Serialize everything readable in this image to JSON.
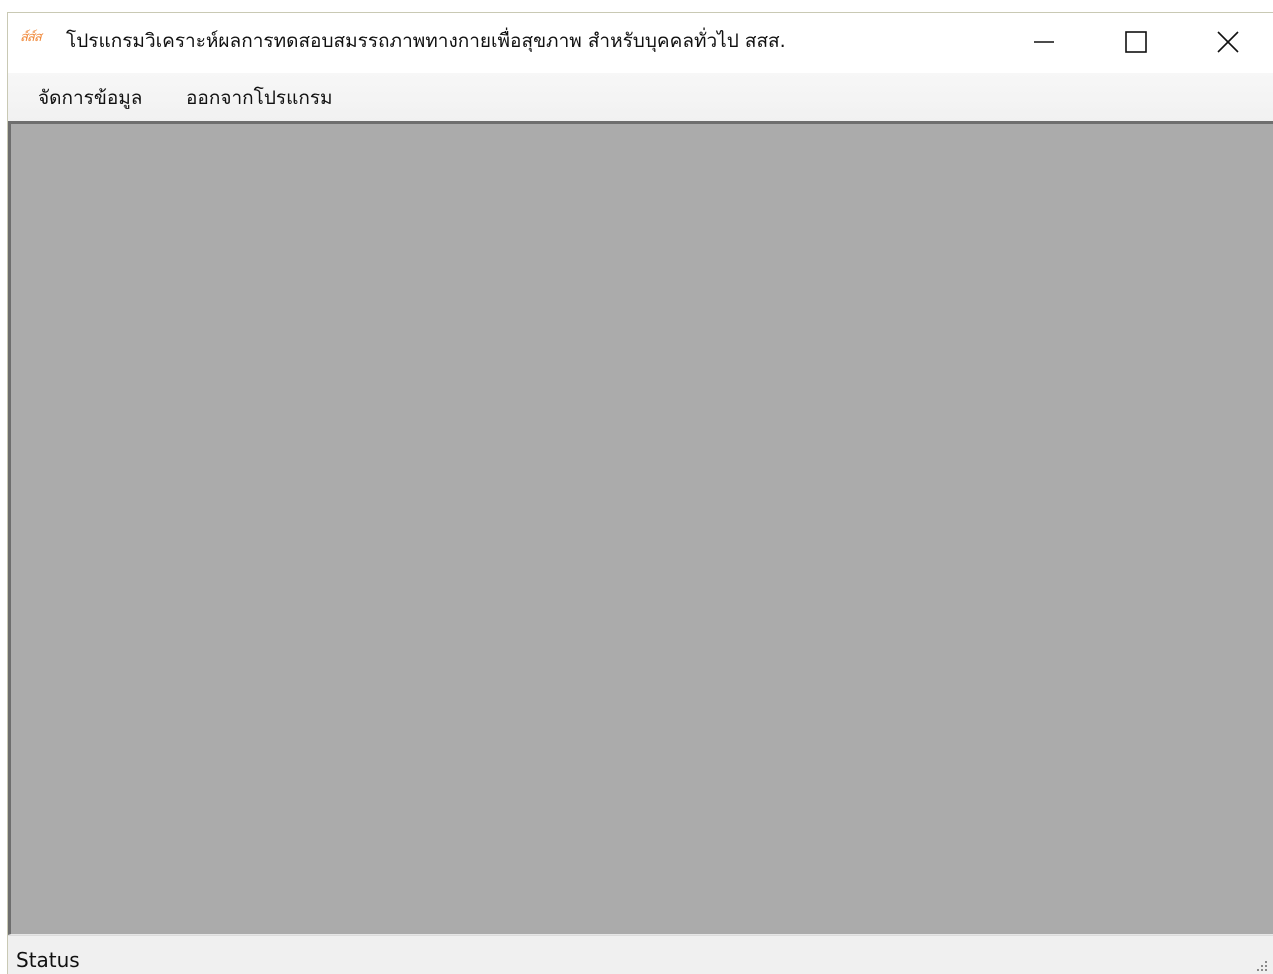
{
  "window": {
    "icon_text": "ส์ส์ส",
    "title": "โปรแกรมวิเคราะห์ผลการทดสอบสมรรถภาพทางกายเพื่อสุขภาพ สำหรับบุคคลทั่วไป สสส.",
    "controls": {
      "minimize": "minimize-icon",
      "maximize": "maximize-icon",
      "close": "close-icon"
    }
  },
  "menubar": {
    "items": [
      {
        "label": "จัดการข้อมูล"
      },
      {
        "label": "ออกจากโปรแกรม"
      }
    ]
  },
  "statusbar": {
    "text": "Status"
  },
  "colors": {
    "mdi_background": "#ababab",
    "icon_accent": "#f08a3c"
  }
}
